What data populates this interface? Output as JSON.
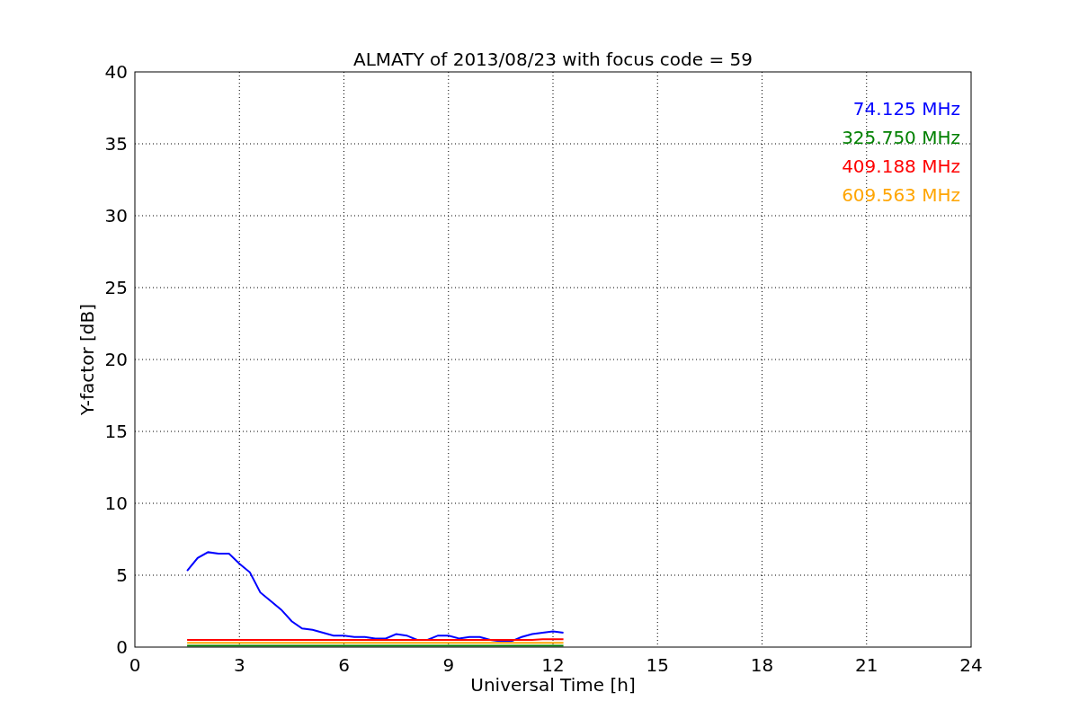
{
  "chart_data": {
    "type": "line",
    "title": "ALMATY of 2013/08/23 with focus code = 59",
    "xlabel": "Universal Time [h]",
    "ylabel": "Y-factor [dB]",
    "x": [
      1.5,
      1.8,
      2.1,
      2.4,
      2.7,
      3.0,
      3.3,
      3.6,
      3.9,
      4.2,
      4.5,
      4.8,
      5.1,
      5.4,
      5.7,
      6.0,
      6.3,
      6.6,
      6.9,
      7.2,
      7.5,
      7.8,
      8.1,
      8.4,
      8.7,
      9.0,
      9.3,
      9.6,
      9.9,
      10.2,
      10.5,
      10.8,
      11.1,
      11.4,
      11.7,
      12.0,
      12.3
    ],
    "series": [
      {
        "name": "74.125 MHz",
        "color": "#0000ff",
        "values": [
          5.3,
          6.2,
          6.6,
          6.5,
          6.5,
          5.8,
          5.2,
          3.8,
          3.2,
          2.6,
          1.8,
          1.3,
          1.2,
          1.0,
          0.8,
          0.8,
          0.7,
          0.7,
          0.6,
          0.6,
          0.9,
          0.8,
          0.5,
          0.5,
          0.8,
          0.8,
          0.6,
          0.7,
          0.7,
          0.5,
          0.4,
          0.4,
          0.7,
          0.9,
          1.0,
          1.1,
          1.0
        ]
      },
      {
        "name": "325.750 MHz",
        "color": "#008000",
        "values": [
          0.1,
          0.1,
          0.1,
          0.1,
          0.1,
          0.1,
          0.1,
          0.1,
          0.1,
          0.1,
          0.1,
          0.1,
          0.1,
          0.1,
          0.1,
          0.1,
          0.1,
          0.1,
          0.1,
          0.1,
          0.1,
          0.1,
          0.1,
          0.1,
          0.1,
          0.1,
          0.1,
          0.1,
          0.1,
          0.1,
          0.1,
          0.1,
          0.1,
          0.1,
          0.1,
          0.1,
          0.1
        ]
      },
      {
        "name": "409.188 MHz",
        "color": "#ff0000",
        "values": [
          0.5,
          0.5,
          0.5,
          0.5,
          0.5,
          0.5,
          0.5,
          0.5,
          0.5,
          0.5,
          0.5,
          0.5,
          0.5,
          0.5,
          0.5,
          0.5,
          0.5,
          0.5,
          0.5,
          0.5,
          0.5,
          0.5,
          0.5,
          0.5,
          0.5,
          0.5,
          0.5,
          0.5,
          0.5,
          0.5,
          0.5,
          0.5,
          0.5,
          0.5,
          0.55,
          0.55,
          0.55
        ]
      },
      {
        "name": "609.563 MHz",
        "color": "#ffa500",
        "values": [
          0.3,
          0.3,
          0.3,
          0.3,
          0.3,
          0.3,
          0.3,
          0.3,
          0.3,
          0.3,
          0.3,
          0.3,
          0.3,
          0.3,
          0.3,
          0.3,
          0.3,
          0.3,
          0.3,
          0.3,
          0.3,
          0.3,
          0.3,
          0.3,
          0.3,
          0.3,
          0.3,
          0.3,
          0.3,
          0.3,
          0.3,
          0.3,
          0.3,
          0.3,
          0.3,
          0.3,
          0.3
        ]
      }
    ],
    "grid": true,
    "xlim": [
      0,
      24
    ],
    "ylim": [
      0,
      40
    ],
    "xticks": [
      0,
      3,
      6,
      9,
      12,
      15,
      18,
      21,
      24
    ],
    "yticks": [
      0,
      5,
      10,
      15,
      20,
      25,
      30,
      35,
      40
    ]
  }
}
